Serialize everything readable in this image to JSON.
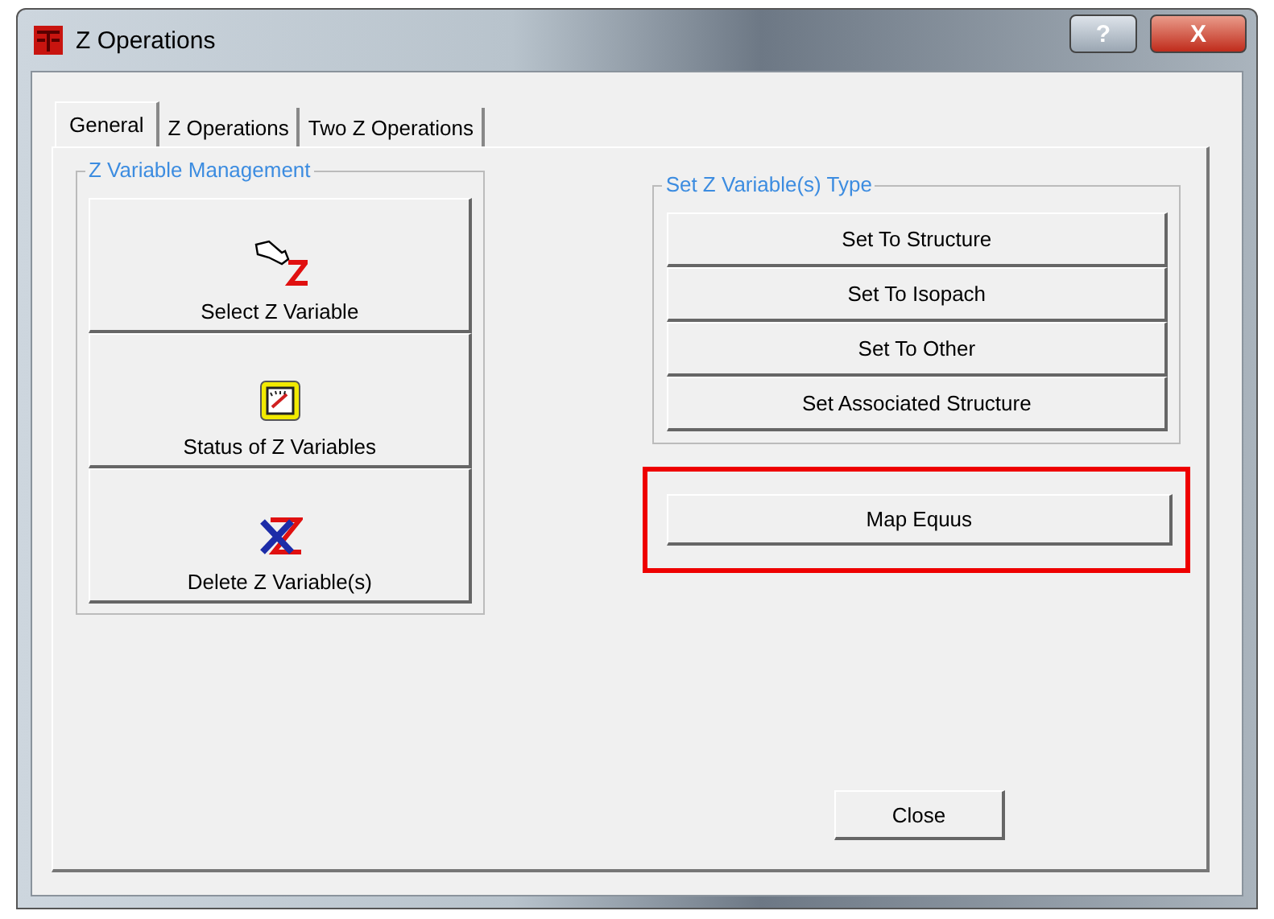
{
  "window": {
    "title": "Z Operations",
    "help_button": "?",
    "close_button": "X"
  },
  "tabs": [
    {
      "label": "General",
      "selected": true
    },
    {
      "label": "Z Operations",
      "selected": false
    },
    {
      "label": "Two Z Operations",
      "selected": false
    }
  ],
  "z_variable_management": {
    "title": "Z Variable Management",
    "buttons": [
      {
        "label": "Select Z Variable",
        "kind": "select"
      },
      {
        "label": "Status of Z Variables",
        "kind": "status"
      },
      {
        "label": "Delete Z Variable(s)",
        "kind": "delete"
      }
    ]
  },
  "set_type": {
    "title": "Set Z Variable(s) Type",
    "buttons": [
      "Set To Structure",
      "Set To Isopach",
      "Set To Other",
      "Set Associated Structure"
    ]
  },
  "map_button": {
    "label": "Map Equus",
    "highlighted": true
  },
  "close_button": "Close"
}
